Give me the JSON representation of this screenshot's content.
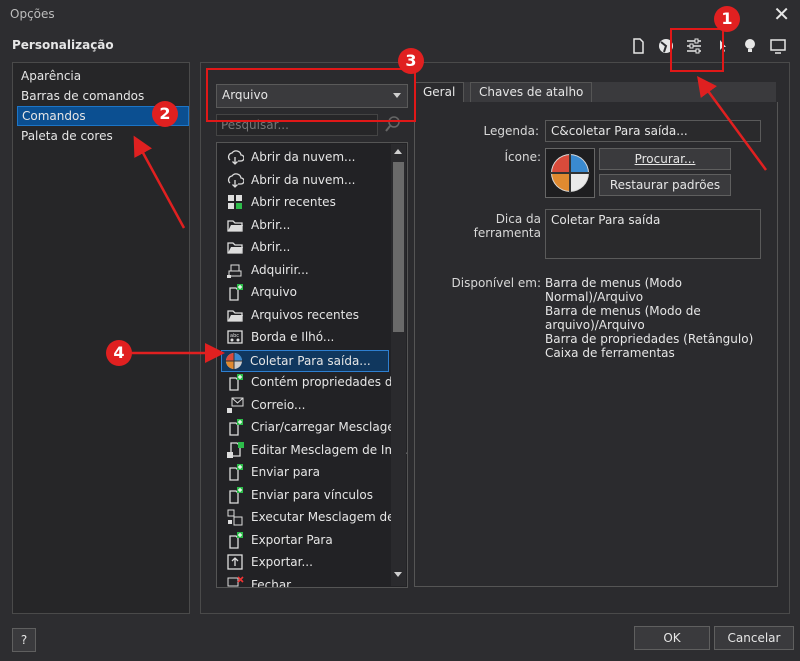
{
  "window": {
    "title": "Opções",
    "close_icon": "close-icon"
  },
  "section_title": "Personalização",
  "toolbar": {
    "icons": [
      "document-icon",
      "globe-icon",
      "customize-sliders-icon",
      "pointer-icon",
      "lightbulb-icon",
      "monitor-icon"
    ]
  },
  "sidebar": {
    "items": [
      {
        "label": "Aparência",
        "selected": false
      },
      {
        "label": "Barras de comandos",
        "selected": false
      },
      {
        "label": "Comandos",
        "selected": true
      },
      {
        "label": "Paleta de cores",
        "selected": false
      }
    ]
  },
  "category_dropdown": {
    "value": "Arquivo"
  },
  "search": {
    "placeholder": "Pesquisar..."
  },
  "commands": [
    {
      "label": "Abrir da nuvem...",
      "icon": "cloud-download-icon"
    },
    {
      "label": "Abrir da nuvem...",
      "icon": "cloud-download-icon"
    },
    {
      "label": "Abrir recentes",
      "icon": "recent-files-icon"
    },
    {
      "label": "Abrir...",
      "icon": "folder-open-icon"
    },
    {
      "label": "Abrir...",
      "icon": "folder-open-icon"
    },
    {
      "label": "Adquirir...",
      "icon": "scanner-icon"
    },
    {
      "label": "Arquivo",
      "icon": "new-document-icon"
    },
    {
      "label": "Arquivos recentes",
      "icon": "folder-open-icon"
    },
    {
      "label": "Borda e Ilhó...",
      "icon": "grommet-icon"
    },
    {
      "label": "Coletar Para saída...",
      "icon": "collect-output-icon",
      "selected": true
    },
    {
      "label": "Contém propriedades d...",
      "icon": "new-document-icon"
    },
    {
      "label": "Correio...",
      "icon": "mail-icon"
    },
    {
      "label": "Criar/carregar Mesclage...",
      "icon": "new-document-icon"
    },
    {
      "label": "Editar Mesclagem de Im...",
      "icon": "merge-edit-icon"
    },
    {
      "label": "Enviar para",
      "icon": "new-document-icon"
    },
    {
      "label": "Enviar para vínculos",
      "icon": "new-document-icon"
    },
    {
      "label": "Executar Mesclagem de...",
      "icon": "merge-run-icon"
    },
    {
      "label": "Exportar Para",
      "icon": "new-document-icon"
    },
    {
      "label": "Exportar...",
      "icon": "export-icon"
    },
    {
      "label": "Fechar",
      "icon": "close-document-icon"
    }
  ],
  "tabs": [
    {
      "label": "Geral",
      "active": true
    },
    {
      "label": "Chaves de atalho",
      "active": false
    }
  ],
  "details": {
    "legend_label": "Legenda:",
    "legend_value": "C&coletar Para saída...",
    "icon_label": "Ícone:",
    "browse_button": "Procurar...",
    "restore_button": "Restaurar padrões",
    "tooltip_label": "Dica da ferramenta",
    "tooltip_value": "Coletar Para saída",
    "available_label": "Disponível em:",
    "available_lines": [
      "Barra de menus (Modo Normal)/Arquivo",
      "Barra de menus (Modo de",
      "arquivo)/Arquivo",
      "Barra de propriedades (Retângulo)",
      "Caixa de ferramentas"
    ]
  },
  "footer": {
    "help_label": "?",
    "ok_label": "OK",
    "cancel_label": "Cancelar"
  },
  "annotations": [
    {
      "number": "1"
    },
    {
      "number": "2"
    },
    {
      "number": "3"
    },
    {
      "number": "4"
    }
  ],
  "colors": {
    "accent": "#0b4f91",
    "annotation": "#e02020",
    "background": "#2d2d30"
  }
}
